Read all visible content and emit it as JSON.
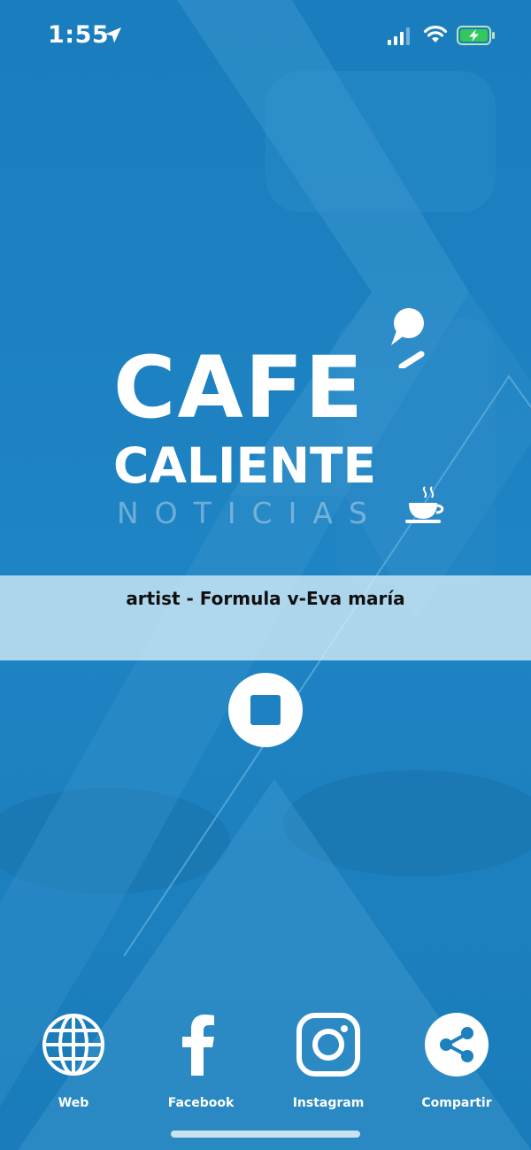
{
  "status_bar": {
    "time": "1:55",
    "icons": [
      "location-arrow-icon",
      "cellular-signal-icon",
      "wifi-icon",
      "battery-charging-icon"
    ]
  },
  "logo": {
    "line1": "CAFE",
    "line2": "CALIENTE",
    "line3": "NOTICIAS"
  },
  "now_playing": {
    "text": "artist - Formula v-Eva maría"
  },
  "player": {
    "control_icon": "stop-icon"
  },
  "bottom_nav": {
    "items": [
      {
        "label": "Web",
        "icon": "globe-icon"
      },
      {
        "label": "Facebook",
        "icon": "facebook-icon"
      },
      {
        "label": "Instagram",
        "icon": "instagram-icon"
      },
      {
        "label": "Compartir",
        "icon": "share-icon"
      }
    ]
  },
  "colors": {
    "background": "#1d80bf",
    "banner": "#cfe8f4",
    "stop_square": "#1e82c2",
    "battery_green": "#34c759"
  }
}
